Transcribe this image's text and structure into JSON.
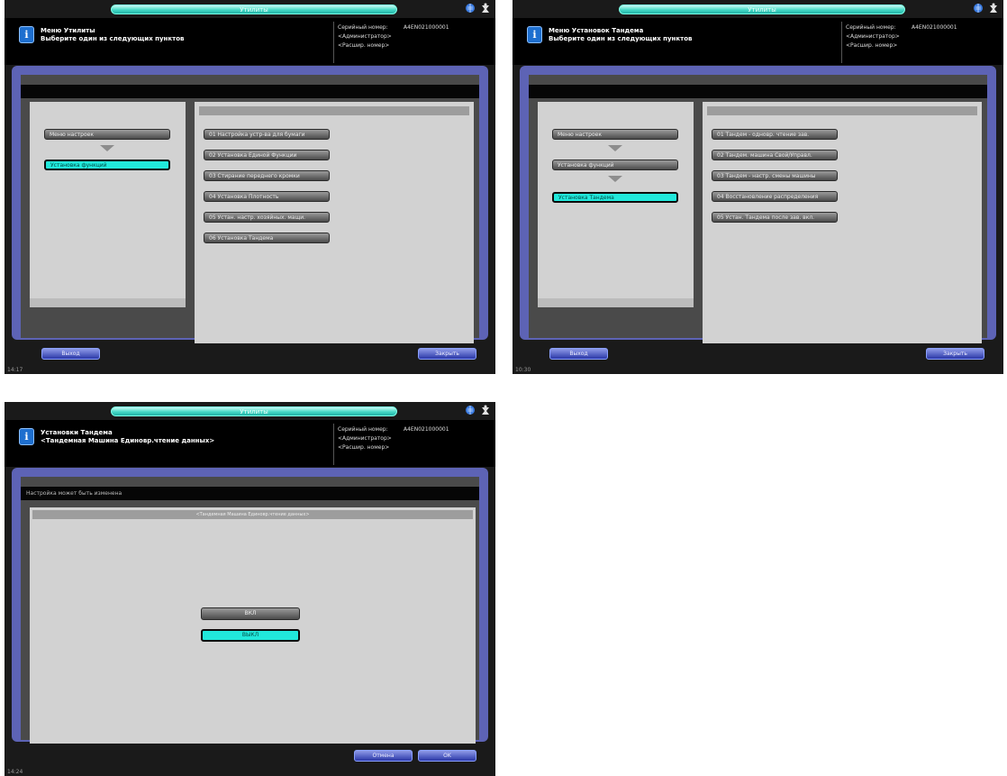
{
  "common": {
    "topbar_title": "Утилиты",
    "serial_label": "Серийный номер:",
    "serial_value": "A4EN021000001",
    "admin_label": "<Администратор>",
    "ext_label": "<Расшир. номер>"
  },
  "screen1": {
    "title_line1": "Меню Утилиты",
    "title_line2": "Выберите один из следующих пунктов",
    "tree": [
      "Меню настроек",
      "Установка функций"
    ],
    "menu": [
      "01 Настройка устр-ва для бумаги",
      "02 Установка Единой Функции",
      "03 Стирание переднего кромки",
      "04 Установка Плотность",
      "05 Устан. настр. хозяйных. мащи.",
      "06 Установка Тандема"
    ],
    "exit_button": "Выход",
    "close_button": "Закрыть",
    "clock": "14:17"
  },
  "screen2": {
    "title_line1": "Меню Установок Тандема",
    "title_line2": "Выберите один из следующих пунктов",
    "tree": [
      "Меню настроек",
      "Установка функций",
      "Установка Тандема"
    ],
    "menu": [
      "01 Тандем - одновр. чтение зав.",
      "02 Тандем. машина Свой/Управл.",
      "03 Тандем - настр. смены машины",
      "04 Восстановление распределения",
      "05 Устан. Тандема после зав. вкл."
    ],
    "exit_button": "Выход",
    "close_button": "Закрыть",
    "clock": "10:30"
  },
  "screen3": {
    "title_line1": "Установки Тандема",
    "title_line2": "<Тандемная Машина Единовр.чтение данных>",
    "strip_text": "Настройка может быть изменена",
    "panel_header": "<Тандемная Машина Единовр.чтение данных>",
    "options": [
      "ВКЛ",
      "ВЫКЛ"
    ],
    "selected": "ВЫКЛ",
    "cancel_button": "Отмена",
    "ok_button": "OK",
    "clock": "14:24"
  }
}
